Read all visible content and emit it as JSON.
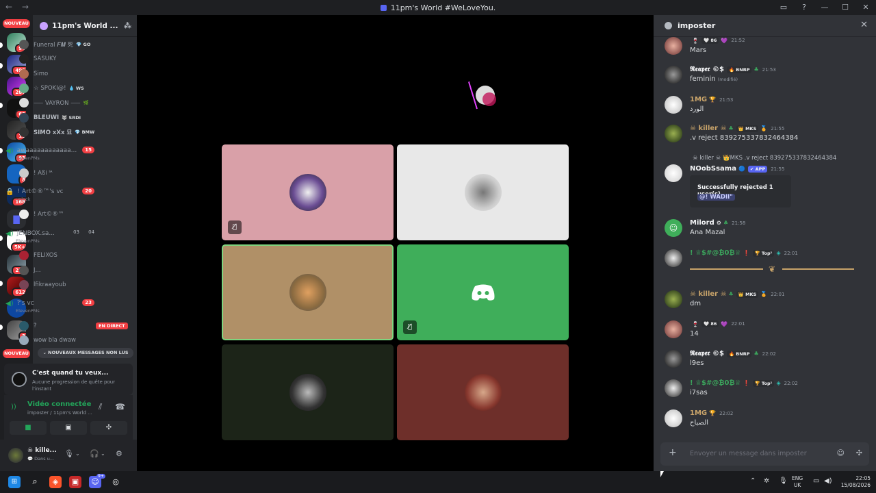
{
  "window": {
    "title": "11pm's World #WeLoveYou.",
    "back_arrow": "←",
    "forward_arrow": "→"
  },
  "rail": {
    "nouveau_top": "NOUVEAU",
    "nouveau_bottom": "NOUVEAU",
    "badges": [
      "94",
      "490",
      "287",
      "63",
      "15",
      "93",
      "8",
      "168",
      "5K+",
      "212",
      "612",
      "",
      "3"
    ]
  },
  "guild": {
    "name": "11pm's World ...",
    "chevron": "⌄"
  },
  "channels": {
    "users_top": [
      {
        "name": "Funeral 𝑭𝑴 死",
        "tag": "💎 GO"
      },
      {
        "name": "SASUKY",
        "tag": ""
      },
      {
        "name": "Simo",
        "tag": ""
      },
      {
        "name": "☆ SPOKI@!",
        "tag": "💧 WS"
      },
      {
        "name": "⸺ VAYRON ⸺",
        "tag": "🌿"
      },
      {
        "name": "BLEUWI",
        "tag": "🐺 SRDI"
      },
      {
        "name": "SIMO xXx 묘",
        "tag": "💎 BMW"
      }
    ],
    "vc1": {
      "name": "awaaaaaaaaaaaa...",
      "sub": "ElevenPMs",
      "count": "15"
    },
    "vc1_user": "! Aßi ᴵᴬ",
    "vc2": {
      "name": "! Art©®™'s vc",
      "sub": "unlock",
      "count": "20"
    },
    "vc2_user": "! Art©®™",
    "vc3": {
      "name": "JENBOX.sa...",
      "sub": "ElevenPMs",
      "count_a": "03",
      "count_b": "04"
    },
    "vc3_users": [
      "FELIXOS",
      "J...",
      "lfikraayoub"
    ],
    "vc4": {
      "name": "?'s vc",
      "sub": "ElevenPMs",
      "count": "23"
    },
    "vc4_users": [
      "?",
      "wow bla dwaw"
    ],
    "live_label": "EN DIRECT",
    "new_messages": "⌄  NOUVEAUX MESSAGES NON LUS"
  },
  "quest": {
    "title": "C'est quand tu veux...",
    "subtitle": "Aucune progression de quête pour l'instant"
  },
  "voice": {
    "status": "Vidéo connectée",
    "location": "imposter / 11pm's World ..."
  },
  "userpanel": {
    "name": "☠ kille...",
    "status": "💬 Dans u..."
  },
  "chat": {
    "channel": "imposter",
    "close": "✕",
    "messages": [
      {
        "author": "Mars",
        "pill": "🤍 86",
        "time": "21:52",
        "text": "Mars",
        "author_hidden": true
      },
      {
        "author": "𝕽𝖊𝖆𝖕𝖊𝖗 ©$",
        "pill": "🔥 BNRP",
        "time": "21:53",
        "text": "feminin",
        "edited": "(modifié)"
      },
      {
        "author": "1MG",
        "pill": "",
        "time": "21:53",
        "text": "الورد"
      },
      {
        "author": "☠ killer ☠",
        "pill": "👑 MKS",
        "time": "21:55",
        "text": ".v reject 839275337832464384"
      },
      {
        "author": "NOobSsama",
        "pill": "✔ APP",
        "time": "21:55",
        "text": "",
        "reply": "☠ killer ☠  👑MKS  .v reject 839275337832464384"
      },
      {
        "author": "Milord",
        "pill": "",
        "time": "21:58",
        "text": "Ana Mazal"
      },
      {
        "author": "!  ♕$#@₿0₿♕",
        "pill": "🏆 Top¹",
        "time": "22:01",
        "text": ""
      },
      {
        "author": "☠ killer ☠",
        "pill": "👑 MKS",
        "time": "22:01",
        "text": "dm"
      },
      {
        "author": "",
        "pill": "🤍 86",
        "time": "22:01",
        "text": "14"
      },
      {
        "author": "𝕽𝖊𝖆𝖕𝖊𝖗 ©$",
        "pill": "🔥 BNRP",
        "time": "22:02",
        "text": "l9es"
      },
      {
        "author": "!  ♕$#@₿0₿♕",
        "pill": "🏆 Top¹",
        "time": "22:02",
        "text": "i7sas"
      },
      {
        "author": "1MG",
        "pill": "",
        "time": "22:02",
        "text": "الصباح"
      }
    ],
    "embed_title": "Successfully rejected 1 user(s)",
    "embed_mention": "@!        WADII\"",
    "input_placeholder": "Envoyer un message dans imposter"
  },
  "taskbar": {
    "lang_line1": "ENG",
    "lang_line2": "UK",
    "time": "22:05",
    "date": "15/08/2026",
    "discord_badge": "9+"
  },
  "colors": {
    "accent": "#5865f2",
    "online_green": "#23a55a",
    "danger": "#f23f43",
    "tile_pink": "#d9a0a8",
    "tile_light": "#e8e8e8",
    "tile_tan": "#b09067",
    "tile_green": "#3fae5a",
    "tile_darkgreen": "#1c2418",
    "tile_maroon": "#6e2f2a"
  }
}
